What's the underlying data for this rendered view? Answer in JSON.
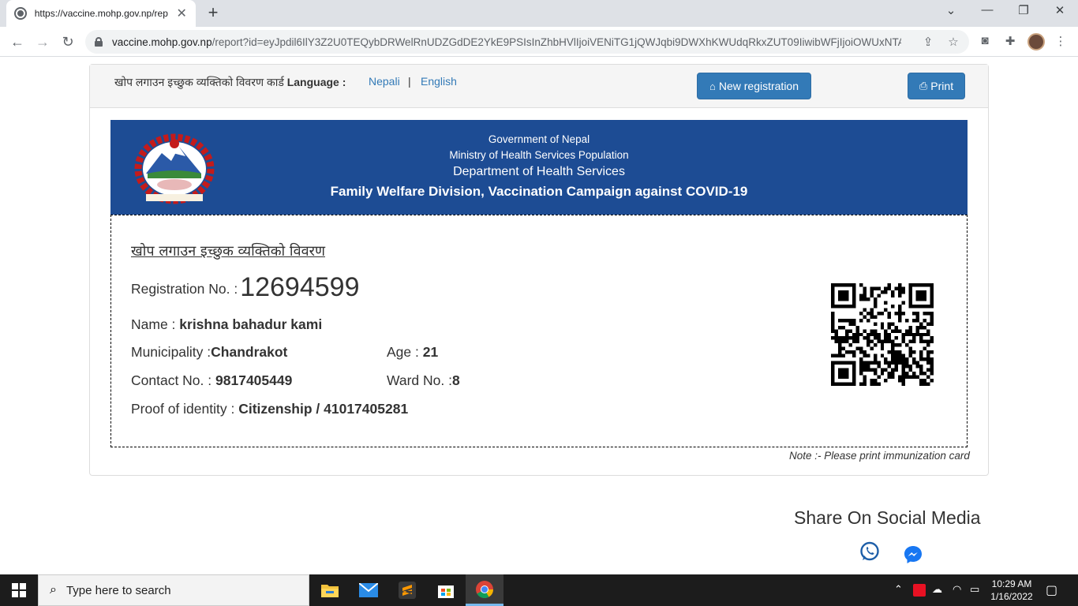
{
  "browser": {
    "tab_title": "https://vaccine.mohp.gov.np/rep",
    "url_host": "vaccine.mohp.gov.np",
    "url_path": "/report?id=eyJpdil6IlY3Z2U0TEQybDRWelRnUDZGdDE2YkE9PSIsInZhbHVlIjoiVENiTG1jQWJqbi9DWXhKWUdqRkxZUT09IiwibWFjIjoiOWUxNTA..."
  },
  "header": {
    "title_prefix": "खोप लगाउन इच्छुक व्यक्तिको विवरण कार्ड",
    "language_label": "Language :",
    "lang_nepali": "Nepali",
    "lang_sep": "|",
    "lang_english": "English",
    "new_registration": "New registration",
    "print": "Print"
  },
  "banner": {
    "line1": "Government of Nepal",
    "line2": "Ministry of Health Services Population",
    "line3": "Department of Health Services",
    "line4": "Family Welfare Division, Vaccination Campaign against COVID-19"
  },
  "card": {
    "subtitle": "खोप लगाउन इच्छुक व्यक्तिको विवरण",
    "reg_label": "Registration No. :",
    "reg_value": "12694599",
    "name_label": "Name :",
    "name_value": "krishna bahadur kami",
    "municipality_label": "Municipality :",
    "municipality_value": "Chandrakot",
    "age_label": "Age :",
    "age_value": "21",
    "contact_label": "Contact No. :",
    "contact_value": "9817405449",
    "ward_label": "Ward No. :",
    "ward_value": "8",
    "proof_label": "Proof of identity :",
    "proof_value": "Citizenship / 41017405281"
  },
  "note": "Note :- Please print immunization card",
  "share": {
    "title": "Share On Social Media"
  },
  "taskbar": {
    "search_placeholder": "Type here to search",
    "time": "10:29 AM",
    "date": "1/16/2022"
  },
  "colors": {
    "banner": "#1d4c94",
    "button": "#337ab7",
    "link": "#337ab7",
    "whatsapp": "#1d5ea8",
    "messenger": "#1877f2"
  }
}
